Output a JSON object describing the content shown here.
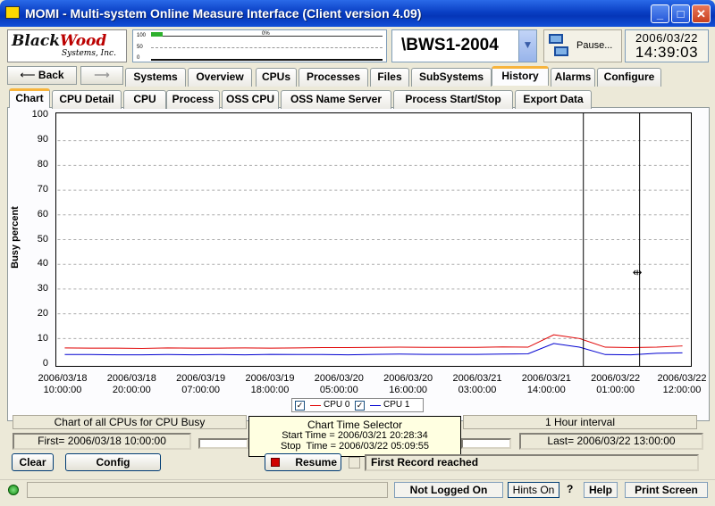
{
  "window": {
    "title": "MOMI - Multi-system Online Measure Interface (Client version 4.09)",
    "min": "_",
    "max": "□",
    "close": "✕"
  },
  "logo": {
    "line1_a": "Black",
    "line1_b": "Wood",
    "line2": "Systems, Inc."
  },
  "minichart": {
    "y_labels": [
      "100",
      "50",
      "0"
    ],
    "percent": "0%",
    "busy_fraction": 0.05
  },
  "system": {
    "name": "\\BWS1-2004",
    "dropdown_icon": "chevron-down-icon"
  },
  "pause": {
    "label": "Pause...",
    "icon": "computers-icon"
  },
  "clock": {
    "date": "2006/03/22",
    "time": "14:39:03"
  },
  "nav": {
    "back": "Back",
    "forward": ""
  },
  "main_tabs": [
    "Systems",
    "Overview",
    "CPUs",
    "Processes",
    "Files",
    "SubSystems",
    "History",
    "Alarms",
    "Configure"
  ],
  "main_tab_active": "History",
  "sub_tabs": [
    "Chart",
    "CPU Detail",
    "CPU",
    "Process",
    "OSS CPU",
    "OSS Name Server",
    "Process Start/Stop",
    "Export Data"
  ],
  "sub_tab_active": "Chart",
  "chart_data": {
    "type": "line",
    "ylabel": "Busy percent",
    "xlabel": "",
    "ylim": [
      0,
      100
    ],
    "yticks": [
      "100",
      "90",
      "80",
      "70",
      "60",
      "50",
      "40",
      "30",
      "20",
      "10",
      "0"
    ],
    "xticks": [
      [
        "2006/03/18",
        "10:00:00"
      ],
      [
        "2006/03/18",
        "20:00:00"
      ],
      [
        "2006/03/19",
        "07:00:00"
      ],
      [
        "2006/03/19",
        "18:00:00"
      ],
      [
        "2006/03/20",
        "05:00:00"
      ],
      [
        "2006/03/20",
        "16:00:00"
      ],
      [
        "2006/03/21",
        "03:00:00"
      ],
      [
        "2006/03/21",
        "14:00:00"
      ],
      [
        "2006/03/22",
        "01:00:00"
      ],
      [
        "2006/03/22",
        "12:00:00"
      ]
    ],
    "grid": true,
    "legend_position": "bottom-center",
    "series": [
      {
        "name": "CPU 0",
        "color": "#e00000",
        "values": [
          6.2,
          6.1,
          6.1,
          6.0,
          6.2,
          6.1,
          6.1,
          6.2,
          6.1,
          6.2,
          6.3,
          6.3,
          6.4,
          6.5,
          6.4,
          6.4,
          6.4,
          6.6,
          6.5,
          11.5,
          10,
          6.5,
          6.3,
          6.5,
          7.0
        ]
      },
      {
        "name": "CPU 1",
        "color": "#0000d0",
        "values": [
          3.5,
          3.5,
          3.4,
          3.4,
          3.5,
          3.4,
          3.5,
          3.4,
          3.6,
          3.5,
          3.5,
          3.4,
          3.6,
          3.7,
          3.6,
          3.6,
          3.6,
          3.7,
          3.8,
          8.0,
          6.5,
          3.5,
          3.4,
          4.0,
          4.2
        ]
      }
    ],
    "selectors_x": [
      0.832,
      0.921
    ]
  },
  "legend": {
    "cpu0": "CPU 0",
    "cpu1": "CPU 1",
    "check": "✓"
  },
  "bottom": {
    "chart_desc": "Chart of all CPUs for CPU Busy",
    "interval": "1 Hour interval",
    "first": "First= 2006/03/18 10:00:00",
    "last": "Last= 2006/03/22 13:00:00",
    "tooltip_title": "Chart Time Selector",
    "tooltip_start": "Start Time = 2006/03/21 20:28:34",
    "tooltip_stop": "Stop  Time = 2006/03/22 05:09:55",
    "clear": "Clear",
    "config": "Config",
    "resume": "Resume",
    "first_record": "First Record reached"
  },
  "status": {
    "not_logged_on": "Not Logged On",
    "hints_on": "Hints On",
    "question": "?",
    "help": "Help",
    "print_screen": "Print Screen"
  }
}
